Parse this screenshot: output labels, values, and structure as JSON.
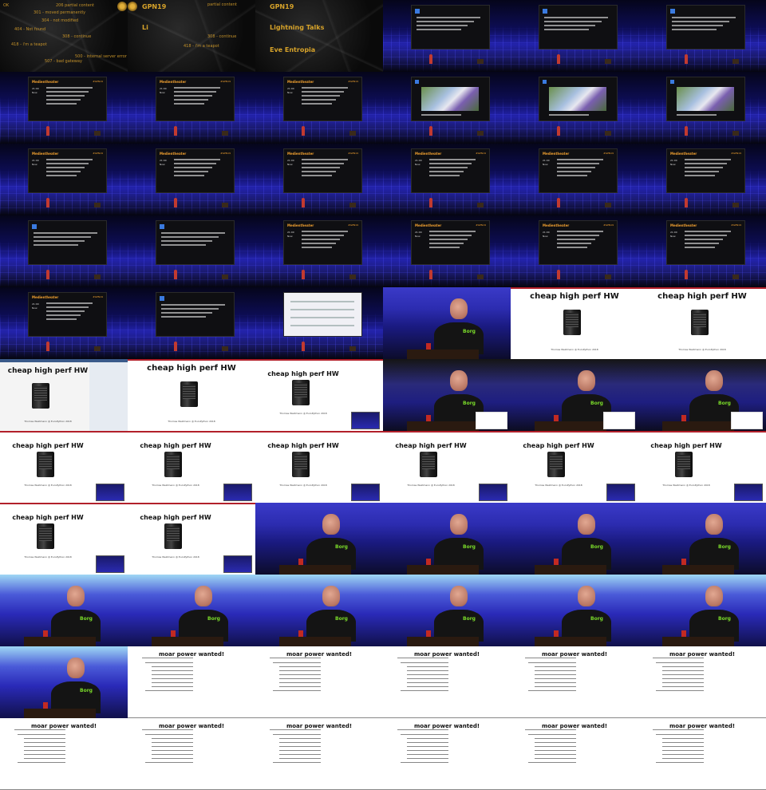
{
  "intro": {
    "http_codes": [
      "OK",
      "206 partial content",
      "301 - moved permanently",
      "304 - not modified",
      "404 - Not found",
      "308 - continue",
      "418 - i'm a teapot",
      "500 - internal server error",
      "507 - bad gateway",
      "308 - continue",
      "418 - i'm a teapot",
      "partial content"
    ],
    "event": "GPN19",
    "talk": "Lightning Talks",
    "speaker": "Eve Entropia",
    "letters": "Li"
  },
  "schedule_screen": {
    "room": "Medientheater",
    "tag": "#GPN19",
    "time": "21:00",
    "now_label": "Now"
  },
  "slides": {
    "hw_title": "cheap high perf HW",
    "hw_credit": "Thomas Waldmann @ EuroPython 2018",
    "power_title": "moar power wanted!"
  },
  "shirt_text": "Borg",
  "colors": {
    "stage_blue": "#2222aa",
    "slide_red": "#b2202a",
    "intro_gold": "#d7a32a",
    "shirt_green": "#7bdc2a"
  }
}
